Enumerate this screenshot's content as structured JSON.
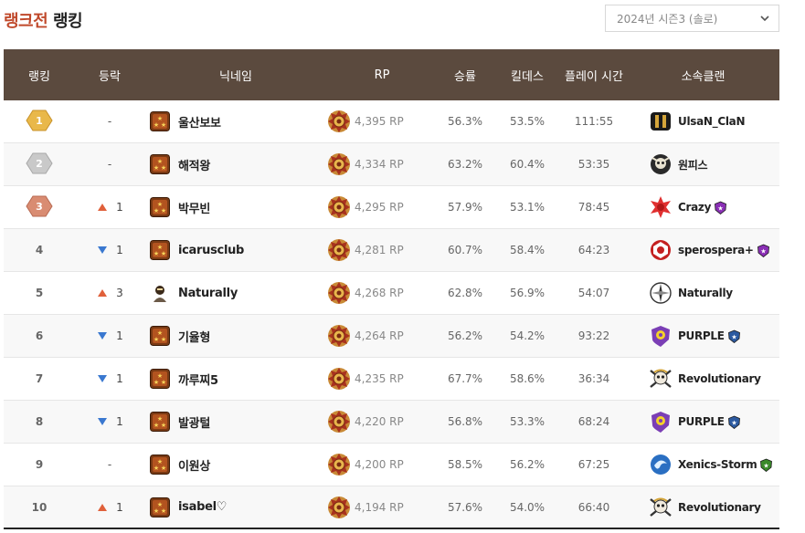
{
  "title": {
    "accent": "랭크전",
    "rest": "랭킹"
  },
  "season_select": {
    "value": "2024년 시즌3 (솔로)"
  },
  "headers": {
    "rank": "랭킹",
    "change": "등락",
    "nickname": "닉네임",
    "rp": "RP",
    "winrate": "승률",
    "kd": "킬데스",
    "playtime": "플레이 시간",
    "clan": "소속클랜"
  },
  "colors": {
    "header_bg": "#5b4a3e",
    "title_accent": "#c0492b",
    "arrow_up": "#e0603a",
    "arrow_down": "#3a78d0",
    "medal_gold": "#e9b84a",
    "medal_silver": "#c9c9c9",
    "medal_bronze": "#d98c72"
  },
  "rows": [
    {
      "rank": "1",
      "medal": "gold",
      "change_dir": "none",
      "change": "-",
      "nickname": "울산보보",
      "nick_icon": "rank-badge-icon",
      "rp": "4,395 RP",
      "winrate": "56.3%",
      "kd": "53.5%",
      "playtime": "111:55",
      "clan": "UlsaN_ClaN",
      "clan_emblem": "black-gold",
      "clan_badge": "none"
    },
    {
      "rank": "2",
      "medal": "silver",
      "change_dir": "none",
      "change": "-",
      "nickname": "해적왕",
      "nick_icon": "rank-badge-icon",
      "rp": "4,334 RP",
      "winrate": "63.2%",
      "kd": "60.4%",
      "playtime": "53:35",
      "clan": "원피스",
      "clan_emblem": "skull",
      "clan_badge": "none"
    },
    {
      "rank": "3",
      "medal": "bronze",
      "change_dir": "up",
      "change": "1",
      "nickname": "박무빈",
      "nick_icon": "rank-badge-icon",
      "rp": "4,295 RP",
      "winrate": "57.9%",
      "kd": "53.1%",
      "playtime": "78:45",
      "clan": "Crazy",
      "clan_emblem": "red-burst",
      "clan_badge": "purple"
    },
    {
      "rank": "4",
      "medal": "none",
      "change_dir": "down",
      "change": "1",
      "nickname": "icarusclub",
      "nick_icon": "rank-badge-icon",
      "rp": "4,281 RP",
      "winrate": "60.7%",
      "kd": "58.4%",
      "playtime": "64:23",
      "clan": "sperospera+",
      "clan_emblem": "red-seal",
      "clan_badge": "purple"
    },
    {
      "rank": "5",
      "medal": "none",
      "change_dir": "up",
      "change": "3",
      "nickname": "Naturally",
      "nick_icon": "character-icon",
      "rp": "4,268 RP",
      "winrate": "62.8%",
      "kd": "56.9%",
      "playtime": "54:07",
      "clan": "Naturally",
      "clan_emblem": "compass",
      "clan_badge": "none"
    },
    {
      "rank": "6",
      "medal": "none",
      "change_dir": "down",
      "change": "1",
      "nickname": "기율형",
      "nick_icon": "rank-badge-icon",
      "rp": "4,264 RP",
      "winrate": "56.2%",
      "kd": "54.2%",
      "playtime": "93:22",
      "clan": "PURPLE",
      "clan_emblem": "purple-shield",
      "clan_badge": "blue"
    },
    {
      "rank": "7",
      "medal": "none",
      "change_dir": "down",
      "change": "1",
      "nickname": "까루찌5",
      "nick_icon": "rank-badge-icon",
      "rp": "4,235 RP",
      "winrate": "67.7%",
      "kd": "58.6%",
      "playtime": "36:34",
      "clan": "Revolutionary",
      "clan_emblem": "skull-crossbones",
      "clan_badge": "none"
    },
    {
      "rank": "8",
      "medal": "none",
      "change_dir": "down",
      "change": "1",
      "nickname": "발광털",
      "nick_icon": "rank-badge-icon",
      "rp": "4,220 RP",
      "winrate": "56.8%",
      "kd": "53.3%",
      "playtime": "68:24",
      "clan": "PURPLE",
      "clan_emblem": "purple-shield",
      "clan_badge": "blue"
    },
    {
      "rank": "9",
      "medal": "none",
      "change_dir": "none",
      "change": "-",
      "nickname": "이원상",
      "nick_icon": "rank-badge-icon",
      "rp": "4,200 RP",
      "winrate": "58.5%",
      "kd": "56.2%",
      "playtime": "67:25",
      "clan": "Xenics-Storm",
      "clan_emblem": "blue-storm",
      "clan_badge": "green"
    },
    {
      "rank": "10",
      "medal": "none",
      "change_dir": "up",
      "change": "1",
      "nickname": "isabel♡",
      "nick_icon": "rank-badge-icon",
      "rp": "4,194 RP",
      "winrate": "57.6%",
      "kd": "54.0%",
      "playtime": "66:40",
      "clan": "Revolutionary",
      "clan_emblem": "skull-crossbones",
      "clan_badge": "none"
    }
  ]
}
